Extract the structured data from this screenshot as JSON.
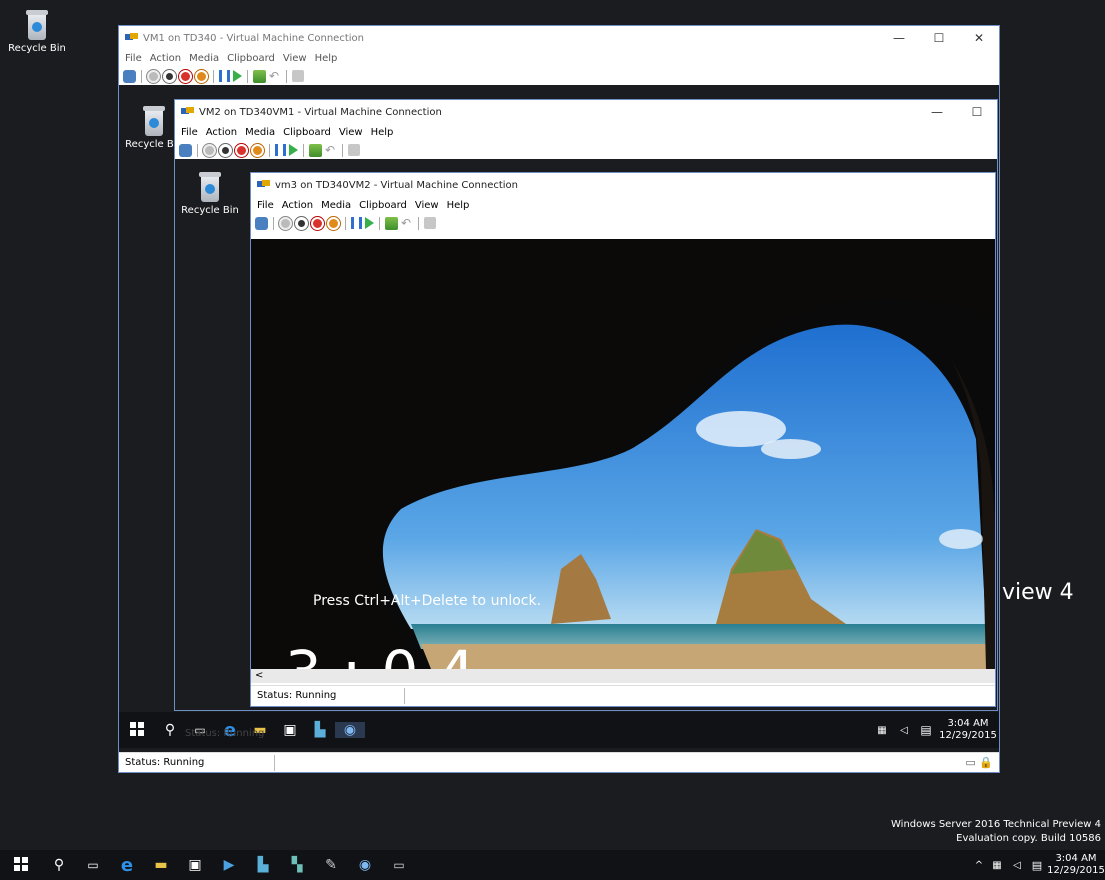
{
  "desktop": {
    "recycle_bin_label": "Recycle Bin",
    "watermark_line1": "Windows Server 2016 Technical Preview 4",
    "watermark_line2": "Evaluation copy. Build 10586",
    "clock_time": "3:04 AM",
    "clock_date": "12/29/2015",
    "overlap_text": "view 4"
  },
  "vm1": {
    "title": "VM1 on TD340 - Virtual Machine Connection",
    "menu": [
      "File",
      "Action",
      "Media",
      "Clipboard",
      "View",
      "Help"
    ],
    "desktop_icon_label": "Recycle Bin",
    "status": "Status: Running"
  },
  "vm2": {
    "title": "VM2 on TD340VM1 - Virtual Machine Connection",
    "menu": [
      "File",
      "Action",
      "Media",
      "Clipboard",
      "View",
      "Help"
    ],
    "desktop_icon_label": "Recycle Bin",
    "status": "Status: Running",
    "status_underlay": "Status: Running",
    "clock_time": "3:04 AM",
    "clock_date": "12/29/2015"
  },
  "vm3": {
    "title": "vm3 on TD340VM2 - Virtual Machine Connection",
    "menu": [
      "File",
      "Action",
      "Media",
      "Clipboard",
      "View",
      "Help"
    ],
    "lock_message": "Press Ctrl+Alt+Delete to unlock.",
    "clock_partial": "3:04",
    "scroll_left": "<",
    "status": "Status: Running"
  },
  "colors": {
    "desktop_bg": "#1b1c1f",
    "window_border": "#6d8fc5",
    "taskbar": "#101216"
  },
  "icons": [
    "windows-start-icon",
    "search-icon",
    "task-view-icon",
    "edge-icon",
    "file-explorer-icon",
    "store-icon",
    "server-manager-icon",
    "hyperv-icon",
    "vmconnect-icon",
    "cmd-icon",
    "network-icon",
    "speaker-icon",
    "notification-icon"
  ]
}
